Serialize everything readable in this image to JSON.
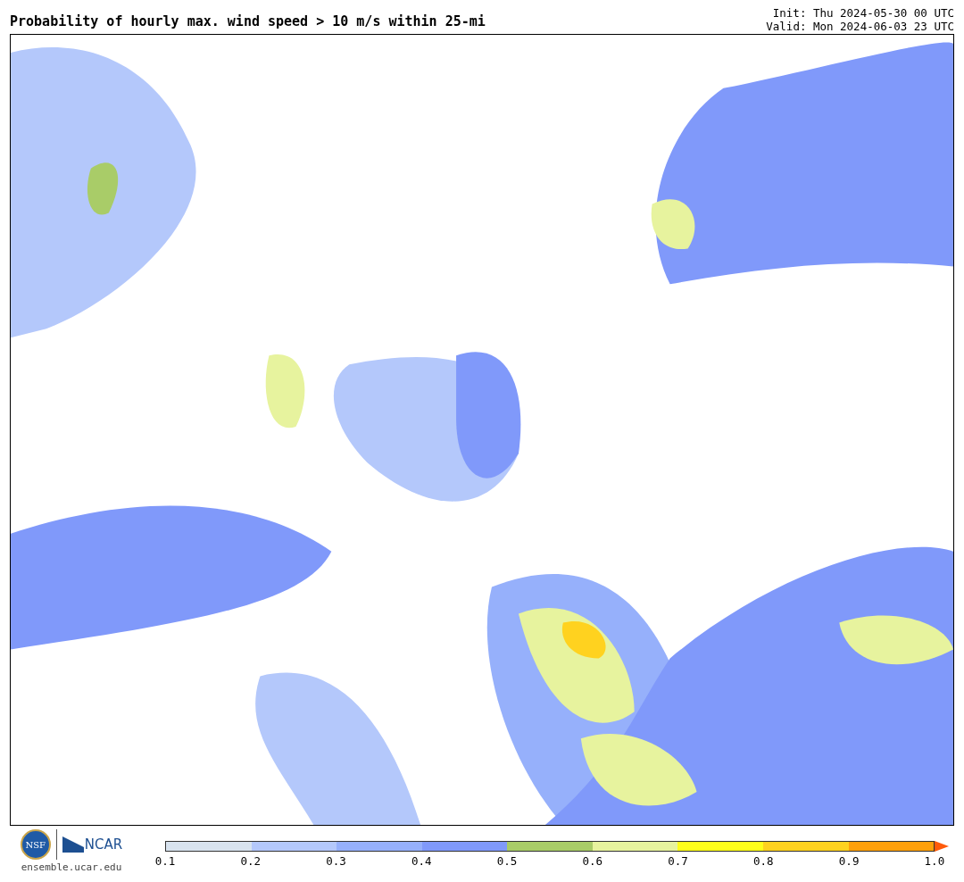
{
  "title": "Probability of hourly max. wind speed > 10 m/s within 25-mi",
  "init": "Init: Thu 2024-05-30 00 UTC",
  "valid": "Valid: Mon 2024-06-03 23 UTC",
  "logos": {
    "nsf": "NSF",
    "ncar": "NCAR",
    "site": "ensemble.ucar.edu"
  },
  "legend": {
    "bins": [
      {
        "kind": "bin",
        "color": "#d8e3ef"
      },
      {
        "kind": "bin",
        "color": "#b4c8fb"
      },
      {
        "kind": "bin",
        "color": "#96b0fb"
      },
      {
        "kind": "bin",
        "color": "#8099fa"
      },
      {
        "kind": "bin",
        "color": "#a9cc68"
      },
      {
        "kind": "bin",
        "color": "#e7f39e"
      },
      {
        "kind": "bin",
        "color": "#ffff1a"
      },
      {
        "kind": "bin",
        "color": "#ffd21f"
      },
      {
        "kind": "bin",
        "color": "#ffa00a"
      },
      {
        "kind": "arrow",
        "color": "#ff5a0a"
      }
    ],
    "ticks": [
      "0.1",
      "0.2",
      "0.3",
      "0.4",
      "0.5",
      "0.6",
      "0.7",
      "0.8",
      "0.9",
      "1.0"
    ]
  }
}
